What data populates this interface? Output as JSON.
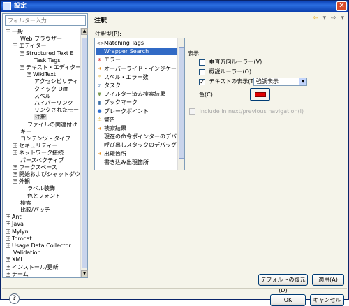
{
  "window": {
    "title": "設定",
    "close_glyph": "✕"
  },
  "filter": {
    "placeholder": "フィルター入力"
  },
  "tree": {
    "items": [
      {
        "label": "一般",
        "toggle": "−"
      },
      {
        "label": "Web ブラウザー",
        "toggle": ""
      },
      {
        "label": "エディター",
        "toggle": "−"
      },
      {
        "label": "Structured Text E",
        "toggle": "−"
      },
      {
        "label": "Task Tags",
        "toggle": ""
      },
      {
        "label": "テキスト・エディター",
        "toggle": "−"
      },
      {
        "label": "WikiText",
        "toggle": "+"
      },
      {
        "label": "アクセシビリティ",
        "toggle": ""
      },
      {
        "label": "クイック Diff",
        "toggle": ""
      },
      {
        "label": "スペル",
        "toggle": ""
      },
      {
        "label": "ハイパーリンク",
        "toggle": ""
      },
      {
        "label": "リンクされたモー",
        "toggle": ""
      },
      {
        "label": "注釈",
        "toggle": ""
      },
      {
        "label": "ファイルの関連付け",
        "toggle": ""
      },
      {
        "label": "キー",
        "toggle": ""
      },
      {
        "label": "コンテンツ・タイプ",
        "toggle": ""
      },
      {
        "label": "セキュリティー",
        "toggle": "+"
      },
      {
        "label": "ネットワーク接続",
        "toggle": "+"
      },
      {
        "label": "パースペクティブ",
        "toggle": ""
      },
      {
        "label": "ワークスペース",
        "toggle": "+"
      },
      {
        "label": "開始およびシャットダウ",
        "toggle": "+"
      },
      {
        "label": "外観",
        "toggle": "−"
      },
      {
        "label": "ラベル装飾",
        "toggle": ""
      },
      {
        "label": "色とフォント",
        "toggle": ""
      },
      {
        "label": "検索",
        "toggle": ""
      },
      {
        "label": "比較/パッチ",
        "toggle": ""
      },
      {
        "label": "Ant",
        "toggle": "+"
      },
      {
        "label": "Java",
        "toggle": "+"
      },
      {
        "label": "Mylyn",
        "toggle": "+"
      },
      {
        "label": "Tomcat",
        "toggle": "+"
      },
      {
        "label": "Usage Data Collector",
        "toggle": "+"
      },
      {
        "label": "Validation",
        "toggle": ""
      },
      {
        "label": "XML",
        "toggle": "+"
      },
      {
        "label": "インストール/更新",
        "toggle": "+"
      },
      {
        "label": "チーム",
        "toggle": "+"
      }
    ]
  },
  "header": {
    "title": "注釈",
    "back_glyph": "⇦",
    "menu_glyph": "▾",
    "forward_glyph": "⇨",
    "more_glyph": "▾"
  },
  "annotation_types": {
    "label": "注釈型(P):",
    "items": [
      {
        "icon": "<>",
        "label": "Matching Tags",
        "color": "#555555"
      },
      {
        "icon": "",
        "label": "Wrapper Search",
        "color": "#316ac5"
      },
      {
        "icon": "⊗",
        "label": "エラー",
        "color": "#d42020"
      },
      {
        "icon": "➜",
        "label": "オーバーライド・インジケーター",
        "color": "#e08000"
      },
      {
        "icon": "⚠",
        "label": "スペル・エラー数",
        "color": "#d0a000"
      },
      {
        "icon": "☑",
        "label": "タスク",
        "color": "#3a6ea5"
      },
      {
        "icon": "▼",
        "label": "フィルター済み検索結果",
        "color": "#7a9a50"
      },
      {
        "icon": "▮",
        "label": "ブックマーク",
        "color": "#3a6ea5"
      },
      {
        "icon": "●",
        "label": "ブレークポイント",
        "color": "#2a6dd0"
      },
      {
        "icon": "⚠",
        "label": "警告",
        "color": "#d0a000"
      },
      {
        "icon": "➜",
        "label": "検索結果",
        "color": "#e08000"
      },
      {
        "icon": "",
        "label": "現在の命令ポインターのデバッグ",
        "color": "#000000"
      },
      {
        "icon": "",
        "label": "呼び出しスタックのデバッグ",
        "color": "#000000"
      },
      {
        "icon": "➜",
        "label": "出現箇所",
        "color": "#e08000"
      },
      {
        "icon": "",
        "label": "書き込み出現箇所",
        "color": "#000000"
      }
    ]
  },
  "display": {
    "label": "表示",
    "vertical_ruler": "垂直方向ルーラー(V)",
    "overview_ruler": "概説ルーラー(O)",
    "show_in_text": "テキストの表示(T)",
    "show_in_text_checked_glyph": "✓",
    "show_in_text_style": "強調表示",
    "color_label": "色(C):",
    "color_value": "#e00000",
    "include_next_prev": "Include in next/previous navigation(I)"
  },
  "buttons": {
    "restore_defaults": "デフォルトの復元(D)",
    "apply": "適用(A)",
    "ok": "OK",
    "cancel": "キャンセル",
    "help": "?"
  }
}
